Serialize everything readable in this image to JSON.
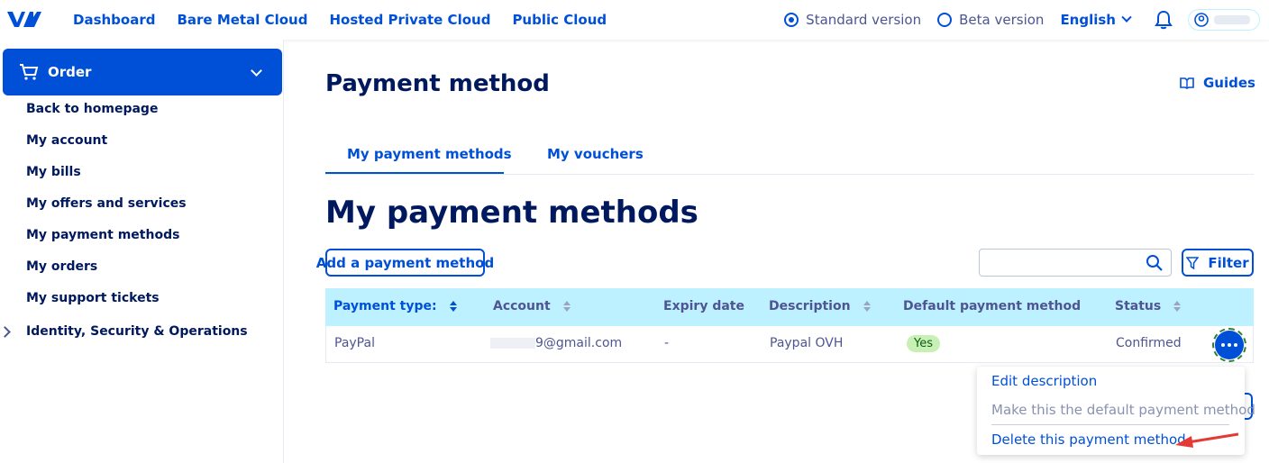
{
  "topnav": {
    "items": [
      "Dashboard",
      "Bare Metal Cloud",
      "Hosted Private Cloud",
      "Public Cloud"
    ],
    "version_standard": "Standard version",
    "version_beta": "Beta version",
    "language": "English"
  },
  "sidebar": {
    "order_label": "Order",
    "items": [
      "Back to homepage",
      "My account",
      "My bills",
      "My offers and services",
      "My payment methods",
      "My orders",
      "My support tickets",
      "Identity, Security & Operations"
    ]
  },
  "main": {
    "page_title": "Payment method",
    "guides_label": "Guides",
    "tabs": [
      "My payment methods",
      "My vouchers"
    ],
    "section_title": "My payment methods",
    "add_button": "Add a payment method",
    "filter_button": "Filter",
    "search_value": ""
  },
  "table": {
    "headers": [
      "Payment type:",
      "Account",
      "Expiry date",
      "Description",
      "Default payment method",
      "Status"
    ],
    "rows": [
      {
        "type": "PayPal",
        "account": "9@gmail.com",
        "expiry": "-",
        "description": "Paypal OVH",
        "default": "Yes",
        "status": "Confirmed"
      }
    ]
  },
  "menu": {
    "items": [
      "Edit description",
      "Make this the default payment method",
      "Delete this payment method"
    ]
  },
  "colors": {
    "primary": "#0050d7",
    "header_bg": "#bef1ff",
    "heading": "#00185e",
    "badge_bg": "#c7f0b5",
    "annotation_arrow": "#e53935"
  }
}
